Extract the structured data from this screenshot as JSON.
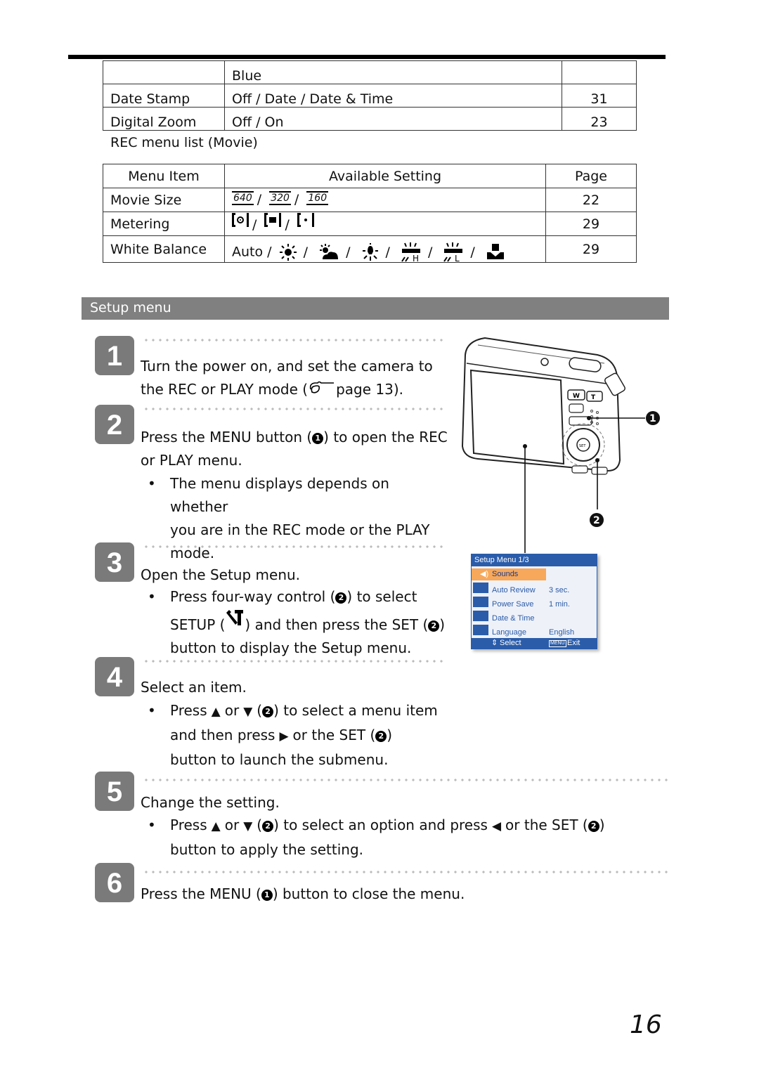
{
  "table_top": {
    "rows": [
      {
        "item": "",
        "setting": "Blue",
        "page": ""
      },
      {
        "item": "Date Stamp",
        "setting": "Off / Date / Date & Time",
        "page": "31"
      },
      {
        "item": "Digital Zoom",
        "setting": "Off / On",
        "page": "23"
      }
    ]
  },
  "movie_table": {
    "heading": "REC menu list (Movie)",
    "headers": [
      "Menu Item",
      "Available Setting",
      "Page"
    ],
    "rows": [
      {
        "item": "Movie Size",
        "icons": [
          "640",
          "320",
          "160"
        ],
        "page": "22"
      },
      {
        "item": "Metering",
        "icons": [
          "center-weighted-metering-icon",
          "average-metering-icon",
          "spot-metering-icon"
        ],
        "page": "29"
      },
      {
        "item": "White Balance",
        "prefix": "Auto /",
        "icons": [
          "daylight-icon",
          "cloudy-icon",
          "tungsten-icon",
          "fluorescent-h-icon",
          "fluorescent-l-icon",
          "manual-wb-icon"
        ],
        "page": "29"
      }
    ]
  },
  "section": {
    "title": "Setup menu"
  },
  "steps": [
    {
      "num": "1",
      "title_a": "Turn the power on, and set the camera to",
      "title_b_pre": "the REC or PLAY mode (",
      "title_b_post": "page 13)."
    },
    {
      "num": "2",
      "title_a": "Press the MENU button (",
      "title_a_mark": "1",
      "title_a_post": ") to open the REC",
      "title_b": "or PLAY menu.",
      "bullet": [
        "The menu displays depends on whether",
        "you are in the REC mode or the PLAY",
        "mode."
      ]
    },
    {
      "num": "3",
      "title": "Open the Setup menu.",
      "bullet_l1_a": "Press four-way control (",
      "bullet_l1_b": ") to select",
      "bullet_l2_a": "SETUP (",
      "bullet_l2_b": ") and then press the SET (",
      "bullet_l2_c": ")",
      "bullet_l3": "button to display the Setup menu."
    },
    {
      "num": "4",
      "title": "Select an item.",
      "bullet_l1_a": "Press",
      "bullet_l1_or": "or",
      "bullet_l1_b": "(",
      "bullet_l1_c": ") to select a menu item",
      "bullet_l2_a": "and then press",
      "bullet_l2_b": "or the SET (",
      "bullet_l2_c": ")",
      "bullet_l3": "button to launch the submenu."
    },
    {
      "num": "5",
      "title": "Change the setting.",
      "bullet_l1_a": "Press",
      "bullet_l1_or": "or",
      "bullet_l1_b": "(",
      "bullet_l1_c": ") to select an option and press",
      "bullet_l1_d": "or the SET (",
      "bullet_l1_e": ")",
      "bullet_l2": "button to apply the setting."
    },
    {
      "num": "6",
      "title_a": "Press the MENU (",
      "title_mark": "1",
      "title_b": ") button to close the menu."
    }
  ],
  "camera": {
    "callout_1": "1",
    "callout_2": "2",
    "zoom_w": "W",
    "zoom_t": "T",
    "set_label": "SET",
    "screen_menu": {
      "title": "Setup Menu 1/3",
      "items": [
        {
          "label": "Sounds",
          "value": "",
          "selected": true
        },
        {
          "label": "Auto Review",
          "value": "3 sec."
        },
        {
          "label": "Power Save",
          "value": "1 min."
        },
        {
          "label": "Date & Time",
          "value": ""
        },
        {
          "label": "Language",
          "value": "English"
        }
      ],
      "footer_select": "Select",
      "footer_menu": "MENU",
      "footer_exit": "Exit",
      "colors": {
        "bar": "#2a5caa",
        "selected": "#f7a85a",
        "bg": "#eef1f8"
      }
    }
  },
  "page_number": "16"
}
